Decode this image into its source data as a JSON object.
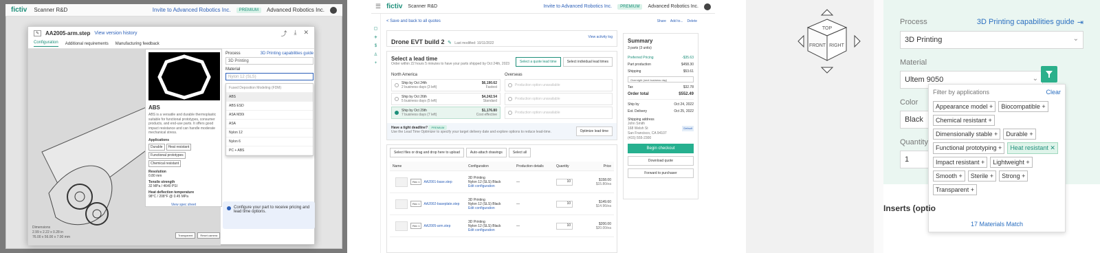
{
  "panel1": {
    "brand": "fictiv",
    "app": "Scanner R&D",
    "invite": "Invite to Advanced Robotics Inc.",
    "badge": "PREMIUM",
    "org": "Advanced Robotics Inc.",
    "file_name": "AA2005-arm.step",
    "version_link": "View version history",
    "tabs": [
      "Configuration",
      "Additional requirements",
      "Manufacturing feedback"
    ],
    "material_card": {
      "name": "ABS",
      "description": "ABS is a versatile and durable thermoplastic suitable for functional prototypes, consumer products, and end-use parts. It offers good impact resistance and can handle moderate mechanical stress.",
      "applications_label": "Applications",
      "applications": [
        "Durable",
        "Heat resistant",
        "Functional prototypes",
        "Chemical resistant"
      ],
      "resolution_label": "Resolution",
      "resolution": "0.80 mm",
      "tensile_label": "Tensile strength",
      "tensile": "32 MPa / 4640 PSI",
      "hdt_label": "Heat deflection temperature",
      "hdt": "98°C / 208°F @ 0.45 MPa",
      "spec_link": "View spec sheet"
    },
    "dimensions_label": "Dimensions",
    "dimensions_in": "2.99 x 2.22 x 0.28 in",
    "dimensions_mm": "76.00 x 56.00 x 7.00 mm",
    "viewer_buttons": [
      "Transparent",
      "Reset camera"
    ],
    "process_label": "Process",
    "capabilities_link": "3D Printing capabilities guide",
    "process_value": "3D Printing",
    "material_label": "Material",
    "material_search": "Nylon 12 (SLS)",
    "material_options": [
      "Fused Deposition Modeling (FDM)",
      "ABS",
      "ABS ESD",
      "ASA M30i",
      "ASA",
      "Nylon 12",
      "Nylon 6",
      "PC + ABS"
    ],
    "info_text": "Configure your part to receive pricing and lead time options."
  },
  "panel2": {
    "brand": "fictiv",
    "app": "Scanner R&D",
    "invite": "Invite to Advanced Robotics Inc.",
    "badge": "PREMIUM",
    "org": "Advanced Robotics Inc.",
    "back": "< Save and back to all quotes",
    "top_actions": [
      "Share",
      "Add to...",
      "Delete"
    ],
    "quote_name": "Drone EVT build 2",
    "last_modified": "Last modified: 10/11/2022",
    "activity_link": "View activity log",
    "lead_title": "Select a lead time",
    "lead_sub": "Order within 22 hours 5 minutes to have your parts shipped by Oct 24th, 2023",
    "lead_buttons": [
      "Select a quote lead time",
      "Select individual lead times"
    ],
    "north_america": "North America",
    "overseas": "Overseas",
    "na_options": [
      {
        "title": "Ship by Oct 24th",
        "sub": "2 business days (3 left)",
        "price": "$6,190.62",
        "tag": "Fastest"
      },
      {
        "title": "Ship by Oct 26th",
        "sub": "5 business days (5 left)",
        "price": "$4,242.54",
        "tag": "Standard"
      },
      {
        "title": "Ship by Oct 29th",
        "sub": "7 business days (7 left)",
        "price": "$1,176.80",
        "tag": "Cost effective"
      }
    ],
    "os_unavailable": "Production option unavailable",
    "deadline_q": "Have a tight deadline?",
    "deadline_badge": "PREMIUM",
    "deadline_text": "Use the Lead Time Optimizer to specify your target delivery date and explore options to reduce lead-time.",
    "optimize_btn": "Optimize lead time",
    "upload_btn": "Select files or drag and drop here to upload",
    "auto_btn": "Auto-attach drawings",
    "select_all": "Select all",
    "columns": [
      "Name",
      "Configuration",
      "Production details",
      "Quantity",
      "Price"
    ],
    "rows": [
      {
        "rev": "Rev 1",
        "name": "AA2001-base.step",
        "cfg1": "3D Printing",
        "cfg2": "Nylon 12 (SLS) Black",
        "edit": "Edit configuration",
        "detail": "—",
        "qty": "10",
        "price": "$158.00",
        "unit": "$15.80/ea"
      },
      {
        "rev": "Rev 1",
        "name": "AA2002-baseplate.step",
        "cfg1": "3D Printing",
        "cfg2": "Nylon 12 (SLS) Black",
        "edit": "Edit configuration",
        "detail": "—",
        "qty": "10",
        "price": "$149.60",
        "unit": "$14.96/ea"
      },
      {
        "rev": "Rev 1",
        "name": "AA2005-arm.step",
        "cfg1": "3D Printing",
        "cfg2": "Nylon 12 (SLS) Black",
        "edit": "Edit configuration",
        "detail": "—",
        "qty": "10",
        "price": "$200.00",
        "unit": "$20.00/ea"
      }
    ],
    "summary": {
      "title": "Summary",
      "parts": "3 parts (3 units)",
      "preferred": "Preferred Pricing",
      "preferred_val": "-$35.63",
      "lines": [
        [
          "Part production",
          "$458.30"
        ],
        [
          "Shipping",
          "$53.61"
        ]
      ],
      "shipping_method": "Overnight (next business day)",
      "tax_label": "Tax",
      "tax": "$32.78",
      "total_label": "Order total",
      "total": "$552.49",
      "ship_by_label": "Ship by",
      "ship_by": "Oct 24, 2022",
      "delivery_label": "Est. Delivery",
      "delivery": "Oct 25, 2022",
      "address_label": "Shipping address",
      "address": [
        "John Smith",
        "168 Welsh St",
        "San Francisco, CA 94107",
        "(415) 555-2300"
      ],
      "default_badge": "Default",
      "checkout": "Begin checkout",
      "download": "Download quote",
      "forward": "Forward to purchaser"
    }
  },
  "panel3": {
    "cube": {
      "top": "TOP",
      "front": "FRONT",
      "right": "RIGHT"
    },
    "process_label": "Process",
    "guide_link": "3D Printing capabilities guide",
    "process_value": "3D Printing",
    "material_label": "Material",
    "material_value": "Ultem 9050",
    "color_label": "Color",
    "color_value": "Black",
    "quantity_label": "Quantity",
    "quantity_value": "1",
    "filter_title": "Filter by applications",
    "clear": "Clear",
    "chips": [
      {
        "label": "Appearance model +",
        "on": false
      },
      {
        "label": "Biocompatible +",
        "on": false
      },
      {
        "label": "Chemical resistant +",
        "on": false
      },
      {
        "label": "Dimensionally stable +",
        "on": false
      },
      {
        "label": "Durable +",
        "on": false
      },
      {
        "label": "Functional prototyping +",
        "on": false
      },
      {
        "label": "Heat resistant ✕",
        "on": true
      },
      {
        "label": "Impact resistant +",
        "on": false
      },
      {
        "label": "Lightweight +",
        "on": false
      },
      {
        "label": "Smooth +",
        "on": false
      },
      {
        "label": "Sterile +",
        "on": false
      },
      {
        "label": "Strong +",
        "on": false
      },
      {
        "label": "Transparent +",
        "on": false
      }
    ],
    "match": "17 Materials Match",
    "inserts": "Inserts (optio"
  }
}
